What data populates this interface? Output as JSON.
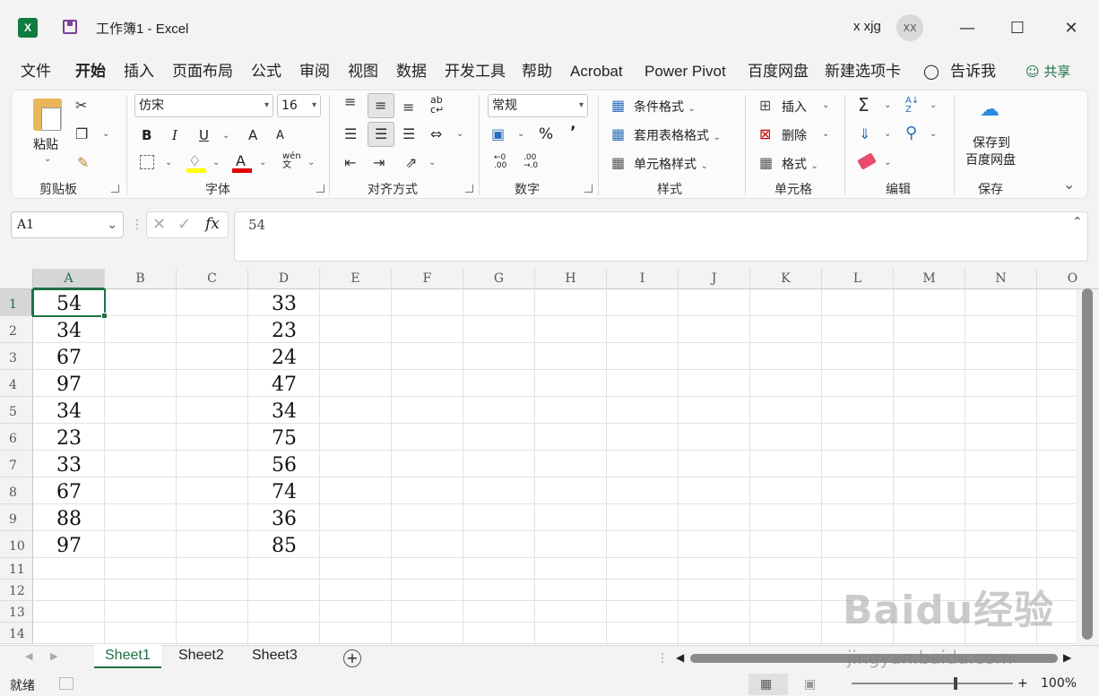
{
  "title": {
    "workbook": "工作簿1",
    "separator": "-",
    "app": "Excel",
    "user": "x xjg",
    "avatar": "XX"
  },
  "window_controls": {
    "minimize": "—",
    "maximize": "☐",
    "close": "✕"
  },
  "menu": [
    "文件",
    "开始",
    "插入",
    "页面布局",
    "公式",
    "审阅",
    "视图",
    "数据",
    "开发工具",
    "帮助",
    "Acrobat",
    "Power Pivot",
    "百度网盘",
    "新建选项卡"
  ],
  "tell_me": "告诉我",
  "share": "共享",
  "ribbon": {
    "clipboard": {
      "paste": "粘贴",
      "label": "剪贴板"
    },
    "font": {
      "name": "仿宋",
      "size": "16",
      "bold": "B",
      "italic": "I",
      "underline": "U",
      "grow": "A",
      "shrink": "A",
      "wen": "wén\n文",
      "label": "字体"
    },
    "alignment": {
      "label": "对齐方式"
    },
    "number": {
      "format": "常规",
      "percent": "%",
      "comma": "’",
      "label": "数字"
    },
    "styles": {
      "conditional": "条件格式",
      "table": "套用表格格式",
      "cell": "单元格样式",
      "label": "样式"
    },
    "cells": {
      "insert": "插入",
      "delete": "删除",
      "format": "格式",
      "label": "单元格"
    },
    "editing": {
      "label": "编辑"
    },
    "save": {
      "line1": "保存到",
      "line2": "百度网盘",
      "label": "保存"
    }
  },
  "formula_bar": {
    "name_box": "A1",
    "fx": "fx",
    "value": "54"
  },
  "columns": [
    "A",
    "B",
    "C",
    "D",
    "E",
    "F",
    "G",
    "H",
    "I",
    "J",
    "K",
    "L",
    "M",
    "N",
    "O"
  ],
  "rows": [
    "1",
    "2",
    "3",
    "4",
    "5",
    "6",
    "7",
    "8",
    "9",
    "10",
    "11",
    "12",
    "13",
    "14"
  ],
  "cells": {
    "A": [
      "54",
      "34",
      "67",
      "97",
      "34",
      "23",
      "33",
      "67",
      "88",
      "97"
    ],
    "D": [
      "33",
      "23",
      "24",
      "47",
      "34",
      "75",
      "56",
      "74",
      "36",
      "85"
    ]
  },
  "sheets": [
    "Sheet1",
    "Sheet2",
    "Sheet3"
  ],
  "status": {
    "ready": "就绪",
    "zoom": "100%"
  },
  "watermark": {
    "brand": "Baidu经验",
    "url": "jingyan.baidu.com"
  },
  "colors": {
    "excel_green": "#1e7145",
    "accent_purple": "#7b3f98"
  }
}
